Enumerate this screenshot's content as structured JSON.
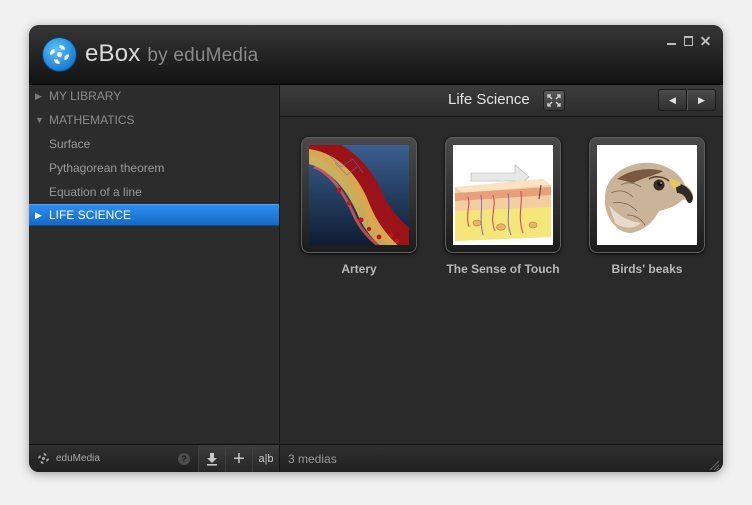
{
  "window": {
    "app_name": "eBox",
    "app_suffix": "by eduMedia",
    "controls": [
      "minimize-icon",
      "maximize-icon",
      "close-icon"
    ]
  },
  "sidebar": {
    "items": [
      {
        "label": "MY LIBRARY",
        "icon": "triangle-right-icon",
        "kind": "section"
      },
      {
        "label": "MATHEMATICS",
        "icon": "triangle-down-icon",
        "kind": "section"
      },
      {
        "label": "Surface",
        "kind": "child"
      },
      {
        "label": "Pythagorean theorem",
        "kind": "child"
      },
      {
        "label": "Equation of a line",
        "kind": "child"
      },
      {
        "label": "LIFE SCIENCE",
        "icon": "triangle-right-icon",
        "kind": "section",
        "selected": true
      }
    ]
  },
  "main": {
    "title": "Life Science",
    "fullscreen_icon": "fullscreen-icon",
    "nav": {
      "prev_icon": "arrow-left-icon",
      "next_icon": "arrow-right-icon"
    },
    "media": [
      {
        "title": "Artery",
        "image": "artery-illustration"
      },
      {
        "title": "The Sense of Touch",
        "image": "skin-cross-section-illustration"
      },
      {
        "title": "Birds' beaks",
        "image": "hawk-head-illustration"
      }
    ]
  },
  "footer": {
    "brand": "eduMedia",
    "help_label": "?",
    "tools": [
      "download-icon",
      "add-icon",
      "rename-icon"
    ],
    "rename_label": "a|b",
    "status": "3 medias"
  },
  "colors": {
    "accent": "#1e7be0",
    "background": "#2a2a2a",
    "text": "#b8b8b8"
  }
}
